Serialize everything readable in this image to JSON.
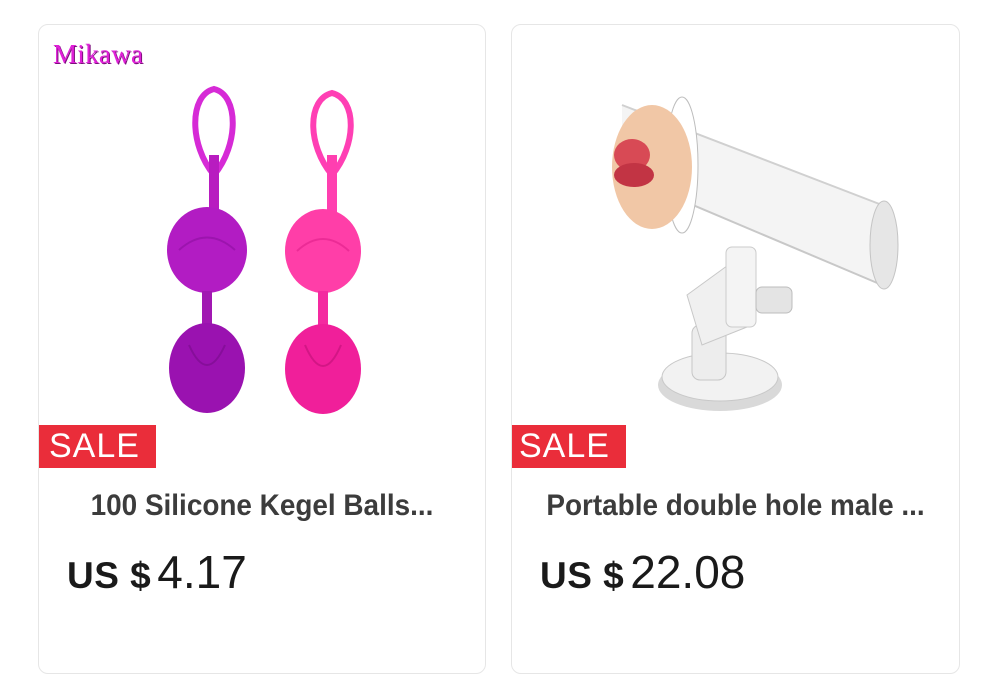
{
  "products": [
    {
      "brand": "Mikawa",
      "badge": "SALE",
      "title": "100  Silicone Kegel Balls...",
      "currency": "US $",
      "price": "4.17",
      "image_icon": "kegel-balls-product-image"
    },
    {
      "brand": "",
      "badge": "SALE",
      "title": "Portable double hole male ...",
      "currency": "US $",
      "price": "22.08",
      "image_icon": "suction-mount-cup-product-image"
    }
  ],
  "colors": {
    "sale_badge": "#ea2d3a",
    "brand_text": "#e020d8",
    "title_text": "#3c3c3c",
    "price_text": "#1a1a1a"
  }
}
